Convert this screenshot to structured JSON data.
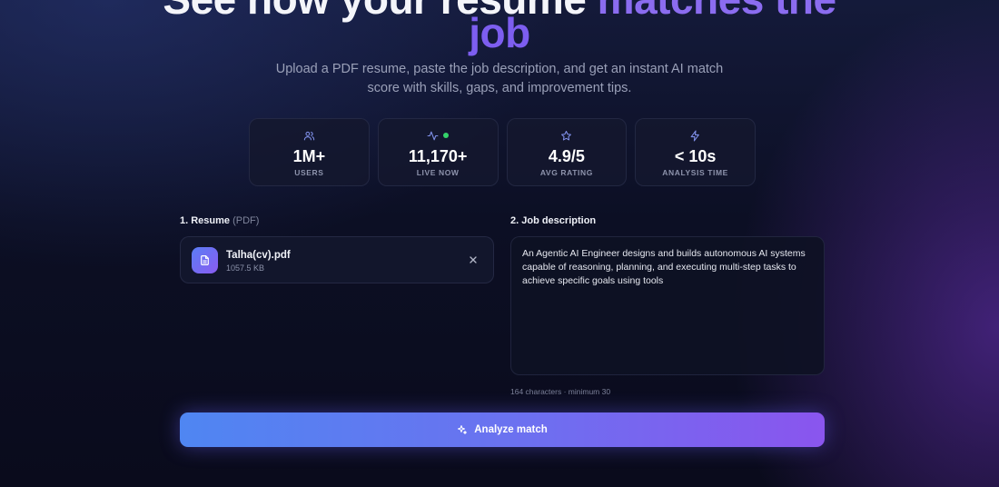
{
  "hero": {
    "title_line1_plain": "See how your resume ",
    "title_line1_accent": "matches the",
    "title_line2_accent": "job",
    "subtitle": "Upload a PDF resume, paste the job description, and get an instant AI match score with skills, gaps, and improvement tips."
  },
  "stats": [
    {
      "icon": "users-icon",
      "value": "1M+",
      "label": "USERS"
    },
    {
      "icon": "activity-icon",
      "value": "11,170+",
      "label": "LIVE NOW",
      "live": true
    },
    {
      "icon": "star-icon",
      "value": "4.9/5",
      "label": "AVG RATING"
    },
    {
      "icon": "bolt-icon",
      "value": "< 10s",
      "label": "ANALYSIS TIME"
    }
  ],
  "resume": {
    "label": "1. Resume",
    "hint": "(PDF)",
    "file_name": "Talha(cv).pdf",
    "file_size": "1057.5 KB"
  },
  "job": {
    "label": "2. Job description",
    "text": "An Agentic AI Engineer designs and builds autonomous AI systems capable of reasoning, planning, and executing multi-step tasks to achieve specific goals using tools",
    "char_count": "164 characters · minimum 30"
  },
  "actions": {
    "analyze_label": "Analyze match"
  },
  "colors": {
    "accent_purple": "#7d5ef0",
    "live_green": "#34d36a",
    "button_start": "#4f86f2",
    "button_end": "#8a55ee"
  }
}
